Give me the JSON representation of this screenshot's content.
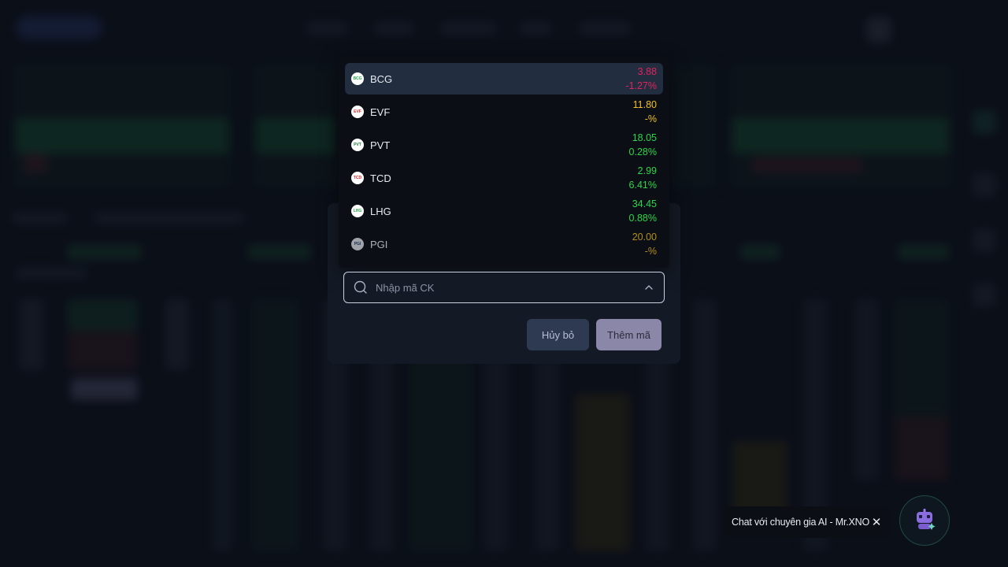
{
  "stock_list": [
    {
      "symbol": "BCG",
      "price": "3.88",
      "change": "-1.27%",
      "color": "#e0245e",
      "logo_bg": "#ffffff",
      "logo_fg": "#2aa44a",
      "logo_text": "BCG"
    },
    {
      "symbol": "EVF",
      "price": "11.80",
      "change": "-%",
      "color": "#f0c020",
      "logo_bg": "#ffffff",
      "logo_fg": "#d62b2b",
      "logo_text": "EVF"
    },
    {
      "symbol": "PVT",
      "price": "18.05",
      "change": "0.28%",
      "color": "#2bd64a",
      "logo_bg": "#ffffff",
      "logo_fg": "#1f7a3a",
      "logo_text": "PVT"
    },
    {
      "symbol": "TCD",
      "price": "2.99",
      "change": "6.41%",
      "color": "#2bd64a",
      "logo_bg": "#ffffff",
      "logo_fg": "#d62b2b",
      "logo_text": "TCD"
    },
    {
      "symbol": "LHG",
      "price": "34.45",
      "change": "0.88%",
      "color": "#2bd64a",
      "logo_bg": "#ffffff",
      "logo_fg": "#2aa44a",
      "logo_text": "LHG"
    },
    {
      "symbol": "PGI",
      "price": "20.00",
      "change": "-%",
      "color": "#f0c020",
      "logo_bg": "#d9dde4",
      "logo_fg": "#1f3a6a",
      "logo_text": "PGI",
      "faded": true
    }
  ],
  "search": {
    "placeholder": "Nhập mã CK",
    "value": ""
  },
  "buttons": {
    "cancel": "Hủy bỏ",
    "add": "Thêm mã"
  },
  "chat": {
    "label": "Chat với chuyên gia AI - Mr.XNO",
    "close_icon": "close-icon",
    "bot_icon": "robot-icon"
  },
  "colors": {
    "up": "#2bd64a",
    "down": "#e0245e",
    "ref": "#f0c020",
    "active_row": "#222d40"
  }
}
